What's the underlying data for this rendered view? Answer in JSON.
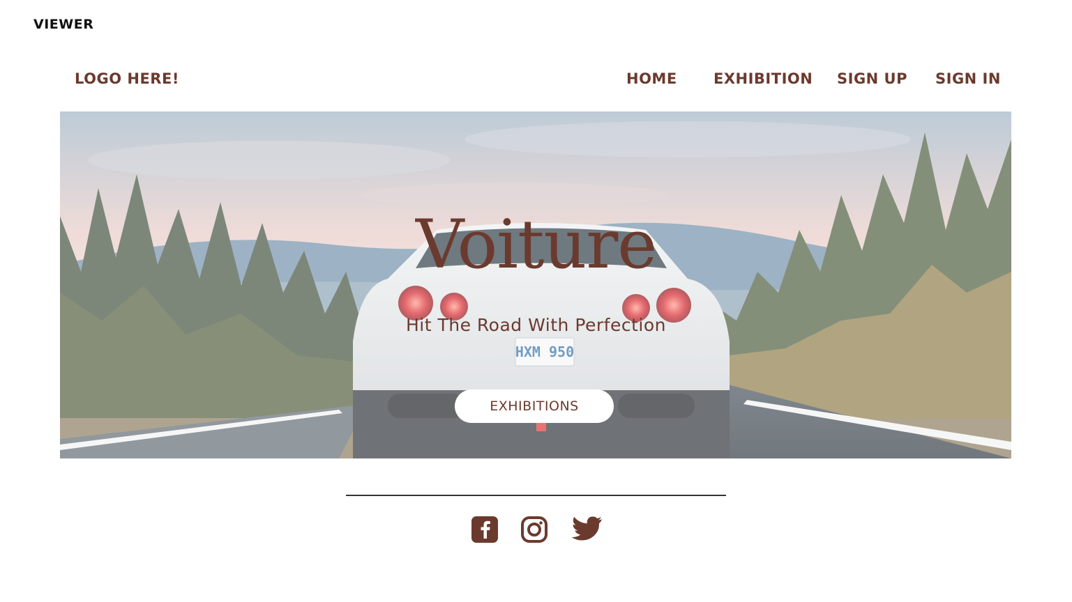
{
  "app": {
    "label": "VIEWER"
  },
  "header": {
    "logo": "LOGO HERE!",
    "nav": [
      {
        "label": "HOME"
      },
      {
        "label": "EXHIBITION"
      },
      {
        "label": "SIGN UP"
      },
      {
        "label": "SIGN IN"
      }
    ]
  },
  "hero": {
    "title": "Voiture",
    "subtitle": "Hit The Road With Perfection",
    "button": "EXHIBITIONS",
    "plate": "HXM 950"
  },
  "footer": {
    "social": [
      {
        "icon": "facebook-icon"
      },
      {
        "icon": "instagram-icon"
      },
      {
        "icon": "twitter-icon"
      }
    ]
  },
  "colors": {
    "brand": "#6b3a2e",
    "text_dark": "#111111",
    "divider": "#333333"
  }
}
